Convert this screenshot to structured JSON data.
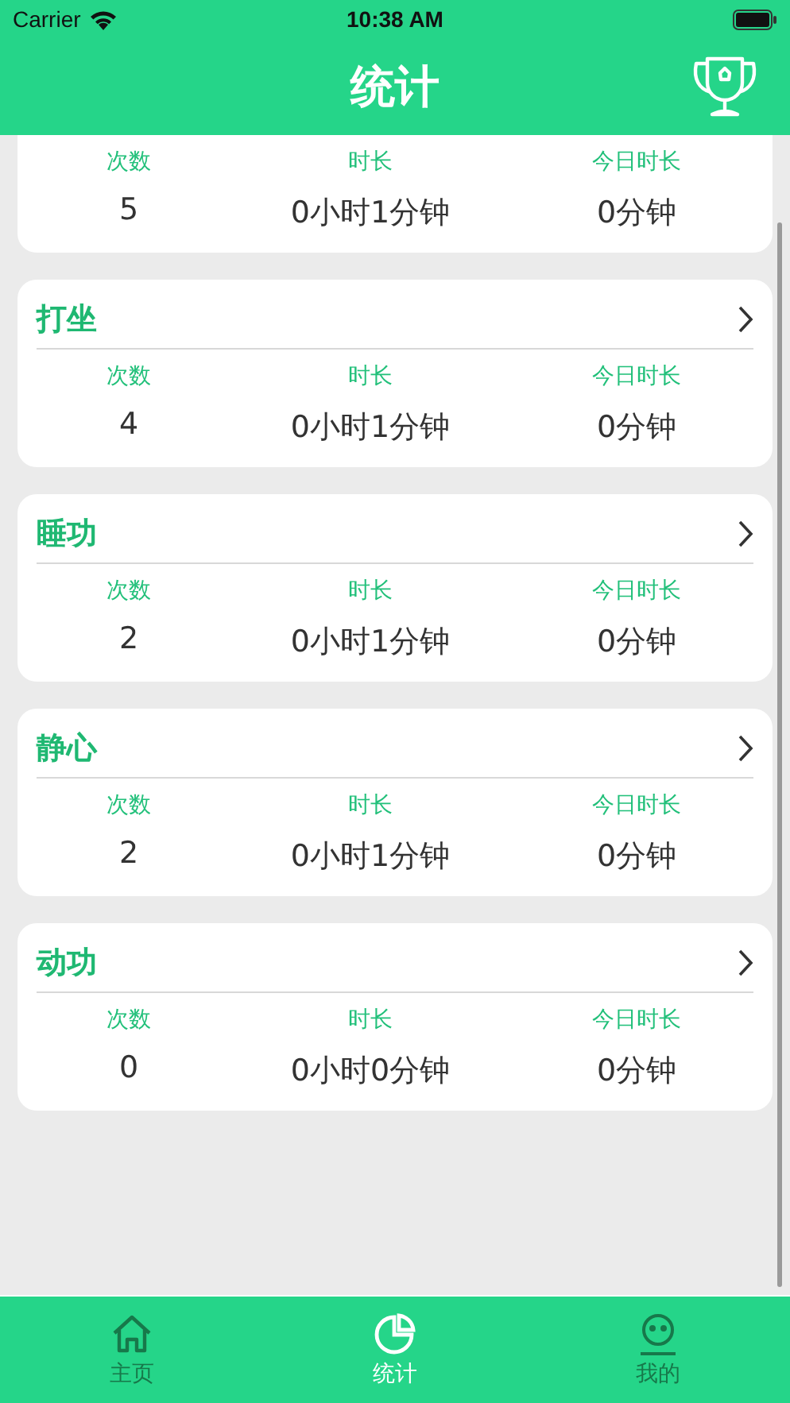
{
  "status_bar": {
    "carrier": "Carrier",
    "time": "10:38 AM"
  },
  "nav_bar": {
    "title": "统计"
  },
  "cards": [
    {
      "stats": [
        {
          "label": "次数",
          "value": "5"
        },
        {
          "label": "时长",
          "value": "0小时1分钟"
        },
        {
          "label": "今日时长",
          "value": "0分钟"
        }
      ]
    },
    {
      "title": "打坐",
      "stats": [
        {
          "label": "次数",
          "value": "4"
        },
        {
          "label": "时长",
          "value": "0小时1分钟"
        },
        {
          "label": "今日时长",
          "value": "0分钟"
        }
      ]
    },
    {
      "title": "睡功",
      "stats": [
        {
          "label": "次数",
          "value": "2"
        },
        {
          "label": "时长",
          "value": "0小时1分钟"
        },
        {
          "label": "今日时长",
          "value": "0分钟"
        }
      ]
    },
    {
      "title": "静心",
      "stats": [
        {
          "label": "次数",
          "value": "2"
        },
        {
          "label": "时长",
          "value": "0小时1分钟"
        },
        {
          "label": "今日时长",
          "value": "0分钟"
        }
      ]
    },
    {
      "title": "动功",
      "stats": [
        {
          "label": "次数",
          "value": "0"
        },
        {
          "label": "时长",
          "value": "0小时0分钟"
        },
        {
          "label": "今日时长",
          "value": "0分钟"
        }
      ]
    }
  ],
  "tab_bar": [
    {
      "kind": "home",
      "label": "主页",
      "selected": false
    },
    {
      "kind": "stats",
      "label": "统计",
      "selected": true
    },
    {
      "kind": "profile",
      "label": "我的",
      "selected": false
    }
  ]
}
